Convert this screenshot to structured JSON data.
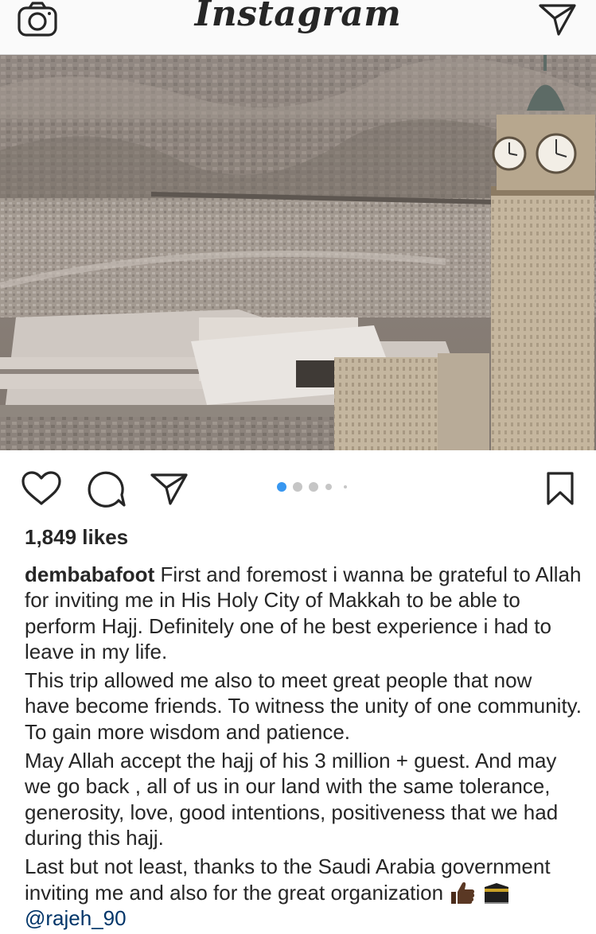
{
  "header": {
    "logo_text": "Instagram",
    "camera_icon": "camera-icon",
    "direct_icon": "paper-plane-icon"
  },
  "post": {
    "image_icon": "photo",
    "likes": "1,849 likes",
    "carousel": {
      "total": 5,
      "active_index": 0,
      "active_color": "#3897f0"
    },
    "actions": [
      "heart-icon",
      "comment-icon",
      "share-icon",
      "bookmark-icon"
    ],
    "caption": {
      "username": "dembabafoot",
      "paragraph_1": "First and foremost i wanna be grateful to Allah for inviting me in His Holy City of Makkah to be able to perform Hajj. Definitely one of he best experience i had to leave in my life.",
      "paragraph_2": "This trip allowed me also to meet great people that now have become friends. To witness the unity of one community. To gain more wisdom and patience.",
      "paragraph_3": "May Allah accept the hajj of his 3 million + guest. And may we go back , all of us in our land with the same tolerance, generosity, love, good intentions, positiveness that we had during this hajj.",
      "paragraph_4": "Last but not least, thanks to the Saudi Arabia government inviting me and also for the great organization",
      "emojis": [
        "thumbs-up-emoji",
        "kaaba-emoji"
      ],
      "mention": "@rajeh_90"
    }
  },
  "colors": {
    "text": "#262626",
    "link": "#003569",
    "accent": "#3897f0",
    "header_bg": "#fafafa"
  }
}
